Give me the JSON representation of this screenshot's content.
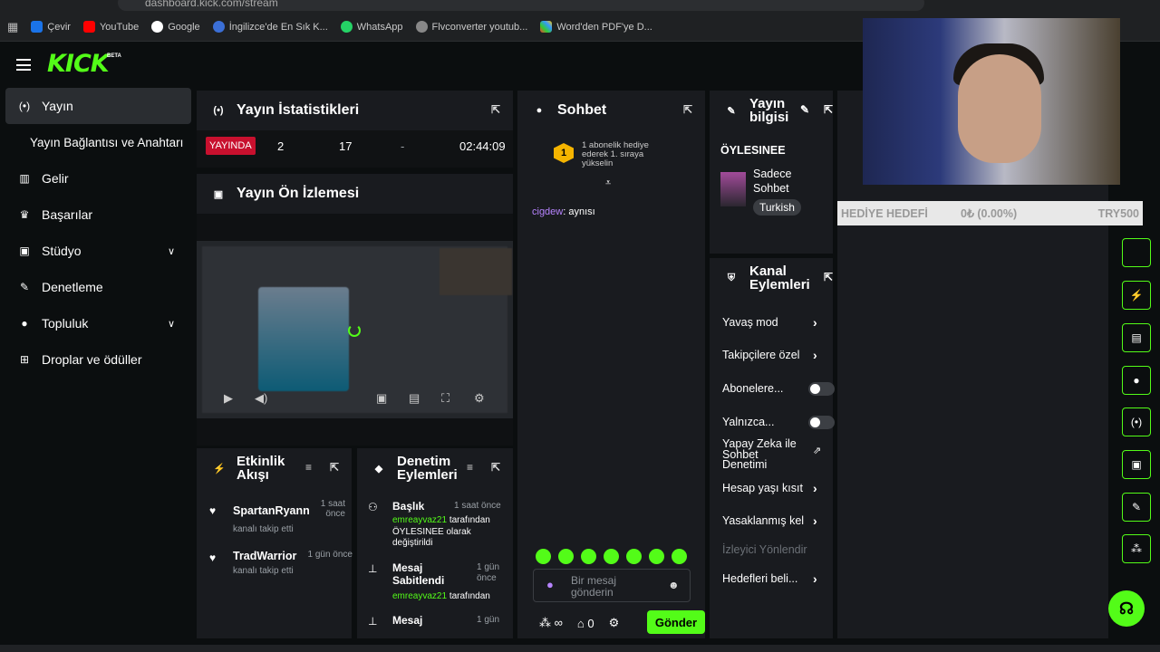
{
  "browser": {
    "url": "dashboard.kick.com/stream",
    "bookmarks": [
      "Çevir",
      "YouTube",
      "Google",
      "İngilizce'de En Sık K...",
      "WhatsApp",
      "Flvconverter youtub...",
      "Word'den PDF'ye D..."
    ]
  },
  "logo": {
    "text": "KICK",
    "badge": "BETA"
  },
  "sidebar": {
    "items": [
      {
        "label": "Yayın"
      },
      {
        "label": "Yayın Bağlantısı ve Anahtarı"
      },
      {
        "label": "Gelir"
      },
      {
        "label": "Başarılar"
      },
      {
        "label": "Stüdyo"
      },
      {
        "label": "Denetleme"
      },
      {
        "label": "Topluluk"
      },
      {
        "label": "Droplar ve ödüller"
      }
    ]
  },
  "stats": {
    "title": "Yayın İstatistikleri",
    "live": "YAYINDA",
    "viewers": "2",
    "followers": "17",
    "dash": "-",
    "duration": "02:44:09"
  },
  "preview": {
    "title": "Yayın Ön İzlemesi"
  },
  "activity": {
    "title1": "Etkinlik",
    "title2": "Akışı",
    "items": [
      {
        "user": "SpartanRyann",
        "time": "1 saat önce",
        "action": "kanalı takip etti"
      },
      {
        "user": "TradWarrior",
        "time": "1 gün önce",
        "action": "kanalı takip etti"
      }
    ]
  },
  "modactions": {
    "title1": "Denetim",
    "title2": "Eylemleri",
    "items": [
      {
        "title": "Başlık",
        "time": "1 saat önce",
        "user": "emreayvaz21",
        "line1": "tarafından",
        "line2": "ÖYLESINEE olarak",
        "line3": "değiştirildi"
      },
      {
        "title": "Mesaj Sabitlendi",
        "time": "1 gün önce",
        "user": "emreayvaz21",
        "line1": "tarafından"
      },
      {
        "title": "Mesaj",
        "time": "1 gün"
      }
    ]
  },
  "chat": {
    "title": "Sohbet",
    "sub_line1": "1 abonelik hediye",
    "sub_line2": "ederek 1. sıraya",
    "sub_line3": "yükselin",
    "sub_rank": "1",
    "message_user": "cigdew",
    "message_text": ": aynısı",
    "placeholder_line1": "Bir mesaj",
    "placeholder_line2": "gönderin",
    "infinity": "∞",
    "count": "0",
    "send": "Gönder"
  },
  "streaminfo": {
    "title1": "Yayın",
    "title2": "bilgisi",
    "stream_title": "ÖYLESINEE",
    "category_line1": "Sadece",
    "category_line2": "Sohbet",
    "language": "Turkish"
  },
  "channel_actions": {
    "title1": "Kanal",
    "title2": "Eylemleri",
    "rows": [
      {
        "label": "Yavaş mod"
      },
      {
        "label": "Takipçilere özel"
      },
      {
        "label": "Abonelere..."
      },
      {
        "label": "Yalnızca..."
      },
      {
        "label": "Yapay Zeka ile Sohbet Denetimi"
      },
      {
        "label": "Hesap yaşı kısıt"
      },
      {
        "label": "Yasaklanmış kel"
      },
      {
        "label": "İzleyici Yönlendir"
      },
      {
        "label": "Hedefleri beli..."
      }
    ]
  },
  "goal": {
    "label": "HEDİYE HEDEFİ",
    "value": "0₺ (0.00%)",
    "target": "TRY500"
  }
}
